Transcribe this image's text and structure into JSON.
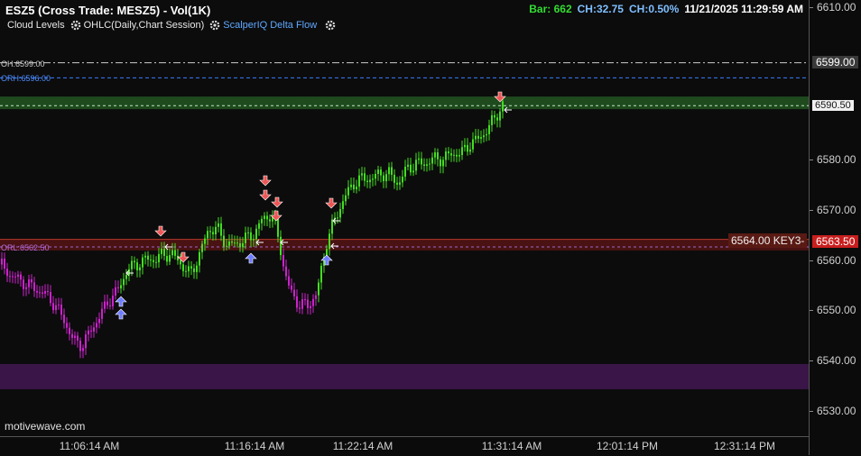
{
  "header": {
    "title": "ESZ5 (Cross Trade: MESZ5) - Vol(1K)",
    "studies": [
      "Cloud Levels",
      "OHLC(Daily,Chart Session)",
      "ScalperIQ Delta Flow"
    ],
    "status": {
      "bar": "Bar: 662",
      "ch_points": "CH:32.75",
      "ch_percent": "CH:0.50%",
      "datetime": "11/21/2025 11:29:59 AM"
    }
  },
  "price_axis": {
    "ticks": [
      "6610.00",
      "6599.00",
      "6590.50",
      "6580.00",
      "6570.00",
      "6563.50",
      "6560.00",
      "6550.00",
      "6540.00",
      "6530.00"
    ]
  },
  "time_axis": {
    "ticks": [
      "11:06:14 AM",
      "11:16:14 AM",
      "11:22:14 AM",
      "11:31:14 AM",
      "12:01:14 PM",
      "12:31:14 PM"
    ]
  },
  "levels": {
    "oh": "OH:6599.00",
    "orh": "ORH:6596.00",
    "orl": "ORL:6562.50",
    "key": "6564.00 KEY3-"
  },
  "watermark": "motivewave.com",
  "colors": {
    "bull": "#44dd22",
    "bear": "#cc22cc",
    "green_zone": "#1e4a1e",
    "red_zone": "#4a1212",
    "purple_zone": "#3a1648",
    "buy_arrow": "#6f7cff",
    "sell_arrow": "#ee5555"
  },
  "chart_data": {
    "type": "candlestick",
    "y_range": [
      6526,
      6611
    ],
    "zones": [
      {
        "from": 6589.8,
        "to": 6592.3,
        "color": "green"
      },
      {
        "from": 6561.8,
        "to": 6564.1,
        "color": "red"
      },
      {
        "from": 6534.3,
        "to": 6539.3,
        "color": "purple"
      }
    ]
  }
}
